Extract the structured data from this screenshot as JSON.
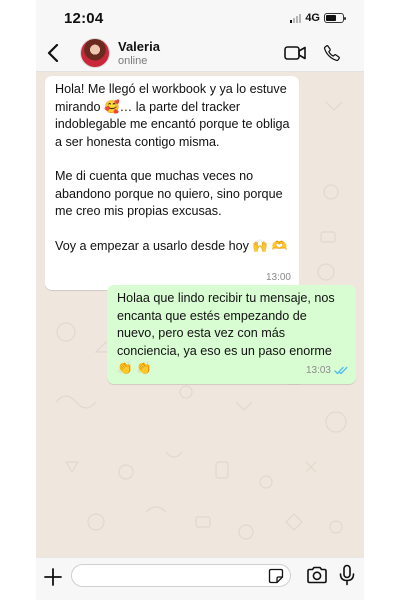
{
  "status_bar": {
    "time": "12:04",
    "network": "4G",
    "battery_level": 0.6
  },
  "header": {
    "contact_name": "Valeria",
    "contact_status": "online",
    "icons": [
      "back-chevron-icon",
      "avatar",
      "video-call-icon",
      "phone-call-icon"
    ]
  },
  "messages": [
    {
      "direction": "incoming",
      "paragraphs": [
        "Hola! Me llegó el workbook y ya lo estuve mirando 🥰… la parte del tracker indoblegable me encantó porque te obliga a ser honesta contigo misma.",
        "Me di cuenta que muchas veces no abandono porque no quiero, sino porque me creo mis propias excusas.",
        "Voy a empezar a usarlo desde hoy 🙌 🫶"
      ],
      "time": "13:00"
    },
    {
      "direction": "outgoing",
      "text": "Holaa que lindo recibir tu mensaje, nos encanta que estés empezando de nuevo, pero esta vez con más conciencia, ya eso es un paso enorme 👏 👏",
      "time": "13:03",
      "read_receipt": "double-check-icon"
    }
  ],
  "composer": {
    "placeholder": "",
    "icons": [
      "plus-icon",
      "sticker-icon",
      "camera-icon",
      "microphone-icon"
    ]
  },
  "colors": {
    "incoming_bubble": "#ffffff",
    "outgoing_bubble": "#d9fdd3",
    "chat_background": "#efe7de",
    "read_tick": "#53bdeb"
  }
}
